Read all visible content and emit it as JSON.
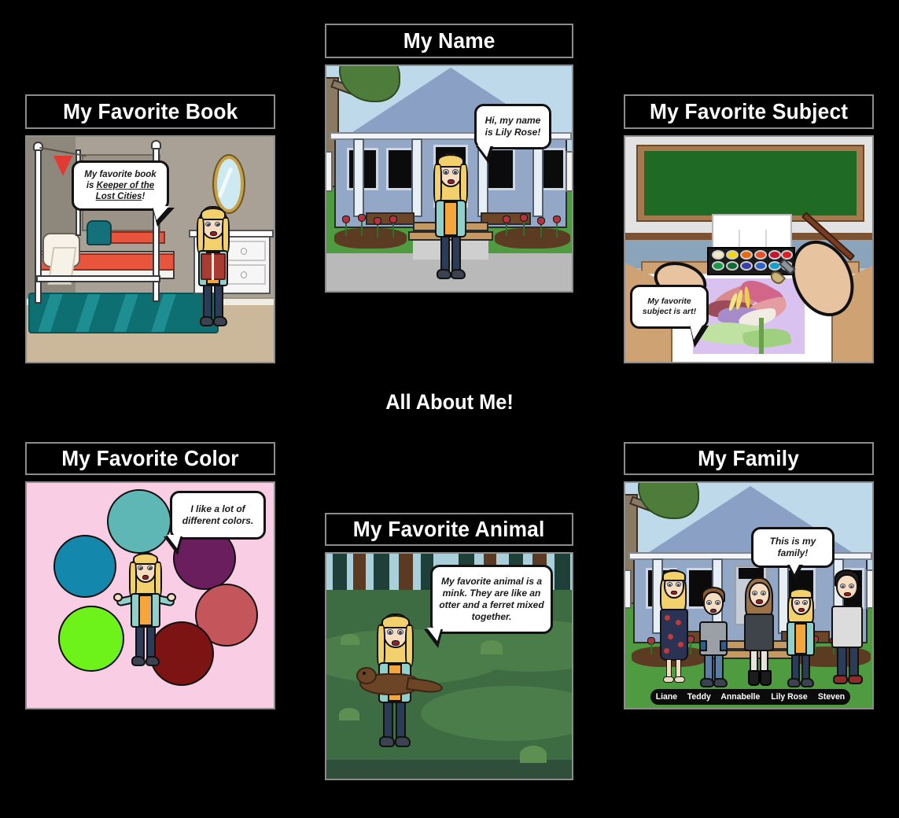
{
  "board": {
    "title": "All About Me!",
    "background_color": "#000000",
    "title_text_color": "#ffffff",
    "panel_border_color": "#8c8c8c"
  },
  "panels": [
    {
      "id": "favorite-book",
      "title": "My Favorite Book",
      "scene": "bedroom",
      "bubble_text_plain": "My favorite book is Keeper of the Lost Cities!",
      "bubble_prefix": "My favorite book is ",
      "bubble_underlined": "Keeper of the Lost Cities",
      "bubble_suffix": "!",
      "colors": {
        "wall": "#a9a195",
        "floor": "#cbb89b",
        "rug": "#0d6f72",
        "blanket": "#e8543c",
        "frame": "#fafafa",
        "mirror": "#c8a24a"
      }
    },
    {
      "id": "my-name",
      "title": "My Name",
      "scene": "house-front",
      "bubble_text": "Hi, my name is Lily Rose!",
      "colors": {
        "sky": "#bdd9ea",
        "house": "#93a7c7",
        "grass": "#4e9c3f",
        "sidewalk": "#b9b9b9",
        "roof_trim": "#6d4628",
        "tulips": "#b5333f"
      }
    },
    {
      "id": "favorite-subject",
      "title": "My Favorite Subject",
      "scene": "art-classroom",
      "bubble_text": "My favorite subject is art!",
      "colors": {
        "chalkboard": "#1f6b25",
        "chalk_frame": "#a7794f",
        "wall": "#e2e2e2",
        "wainscot": "#8aa5bb",
        "desk": "#cfa274",
        "paper": "#ffffff",
        "artwork_bg": "#d9c2ef"
      },
      "palette_colors": [
        "#f2eac2",
        "#f2d513",
        "#e8690f",
        "#e8502a",
        "#c41432",
        "#e01b24",
        "#149944",
        "#0f6b33",
        "#3a3fa8",
        "#2e63c9",
        "#12a0cf",
        "#7b2fa0"
      ]
    },
    {
      "id": "favorite-color",
      "title": "My Favorite Color",
      "scene": "color-circles",
      "bubble_text": "I like a lot of different colors.",
      "background_color": "#f9cde3",
      "circles": [
        {
          "color": "#5fb7b5",
          "label": "teal"
        },
        {
          "color": "#1487ad",
          "label": "blue"
        },
        {
          "color": "#6ef31a",
          "label": "green"
        },
        {
          "color": "#6b1e5e",
          "label": "purple"
        },
        {
          "color": "#c4555a",
          "label": "salmon-red"
        },
        {
          "color": "#7c1414",
          "label": "dark-maroon"
        }
      ]
    },
    {
      "id": "favorite-animal",
      "title": "My Favorite Animal",
      "scene": "forest",
      "bubble_text": "My favorite animal is a mink. They are like an otter and a ferret mixed together.",
      "colors": {
        "background": "#2f4f3a",
        "ground": "#3d6b42",
        "hill": "#4a7d4a",
        "trunk_dark": "#1e4038",
        "trunk_brown": "#5a3a22",
        "mink": "#6b4526"
      }
    },
    {
      "id": "my-family",
      "title": "My Family",
      "scene": "house-front-family",
      "bubble_text": "This is my family!",
      "family_members": [
        {
          "name": "Liane"
        },
        {
          "name": "Teddy"
        },
        {
          "name": "Annabelle"
        },
        {
          "name": "Lily Rose"
        },
        {
          "name": "Steven"
        }
      ]
    }
  ]
}
